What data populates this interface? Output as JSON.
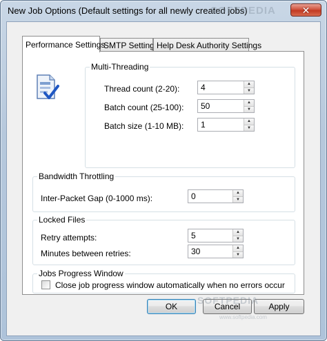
{
  "window": {
    "title": "New Job Options (Default settings for all newly created jobs)",
    "close_symbol": "✕"
  },
  "tabs": [
    {
      "label": "Performance Settings",
      "active": true
    },
    {
      "label": "SMTP Settings",
      "active": false
    },
    {
      "label": "Help Desk Authority Settings",
      "active": false
    }
  ],
  "multithreading": {
    "legend": "Multi-Threading",
    "icon": "document-check-icon",
    "thread_count": {
      "label": "Thread count (2-20):",
      "value": "4"
    },
    "batch_count": {
      "label": "Batch count (25-100):",
      "value": "50"
    },
    "batch_size": {
      "label": "Batch size (1-10 MB):",
      "value": "1"
    }
  },
  "bandwidth": {
    "legend": "Bandwidth Throttling",
    "inter_packet_gap": {
      "label": "Inter-Packet Gap (0-1000 ms):",
      "value": "0"
    }
  },
  "locked_files": {
    "legend": "Locked Files",
    "retry_attempts": {
      "label": "Retry attempts:",
      "value": "5"
    },
    "minutes_between": {
      "label": "Minutes between retries:",
      "value": "30"
    }
  },
  "progress_window": {
    "legend": "Jobs Progress Window",
    "close_auto": {
      "label": "Close job progress window automatically when no errors occur",
      "checked": false
    }
  },
  "buttons": {
    "ok": "OK",
    "cancel": "Cancel",
    "apply": "Apply"
  },
  "watermarks": {
    "top": "SOFTPEDIA",
    "bottom": "SOFTPEDIA",
    "url": "www.softpedia.com"
  },
  "colors": {
    "title_gradient_top": "#c9d7e6",
    "close_red": "#c23a22",
    "default_button_border": "#3c7fb1"
  }
}
